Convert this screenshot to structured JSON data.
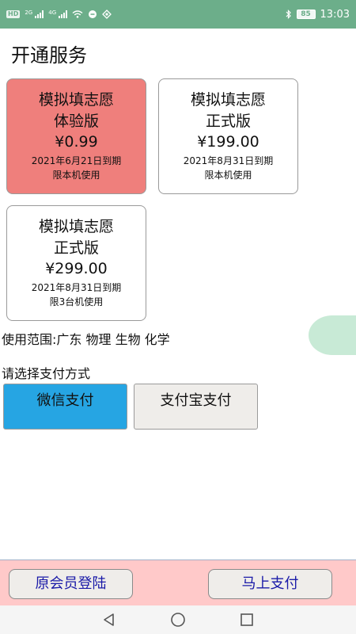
{
  "status_bar": {
    "network_label": "HD",
    "signal1_label": "2G",
    "signal2_label": "4G",
    "battery": "85",
    "time": "13:03"
  },
  "page": {
    "title": "开通服务"
  },
  "plans": [
    {
      "name": "模拟填志愿",
      "edition": "体验版",
      "price": "¥0.99",
      "expire": "2021年6月21日到期",
      "limit": "限本机使用",
      "selected": true
    },
    {
      "name": "模拟填志愿",
      "edition": "正式版",
      "price": "¥199.00",
      "expire": "2021年8月31日到期",
      "limit": "限本机使用",
      "selected": false
    },
    {
      "name": "模拟填志愿",
      "edition": "正式版",
      "price": "¥299.00",
      "expire": "2021年8月31日到期",
      "limit": "限3台机使用",
      "selected": false
    }
  ],
  "scope": {
    "text": "使用范围:广东 物理 生物 化学"
  },
  "payment": {
    "label": "请选择支付方式",
    "wechat": "微信支付",
    "alipay": "支付宝支付",
    "selected": "wechat"
  },
  "bottom": {
    "login_label": "原会员登陆",
    "pay_now_label": "马上支付"
  },
  "colors": {
    "status_bar": "#6cae8a",
    "selected_card": "#ef7f7c",
    "wechat_selected": "#26a5e3",
    "bottom_bar": "#ffc9c9",
    "bottom_button_text": "#1a1aa8"
  },
  "icons": {
    "nav_back": "back-triangle-icon",
    "nav_home": "home-circle-icon",
    "nav_recent": "recent-square-icon"
  }
}
